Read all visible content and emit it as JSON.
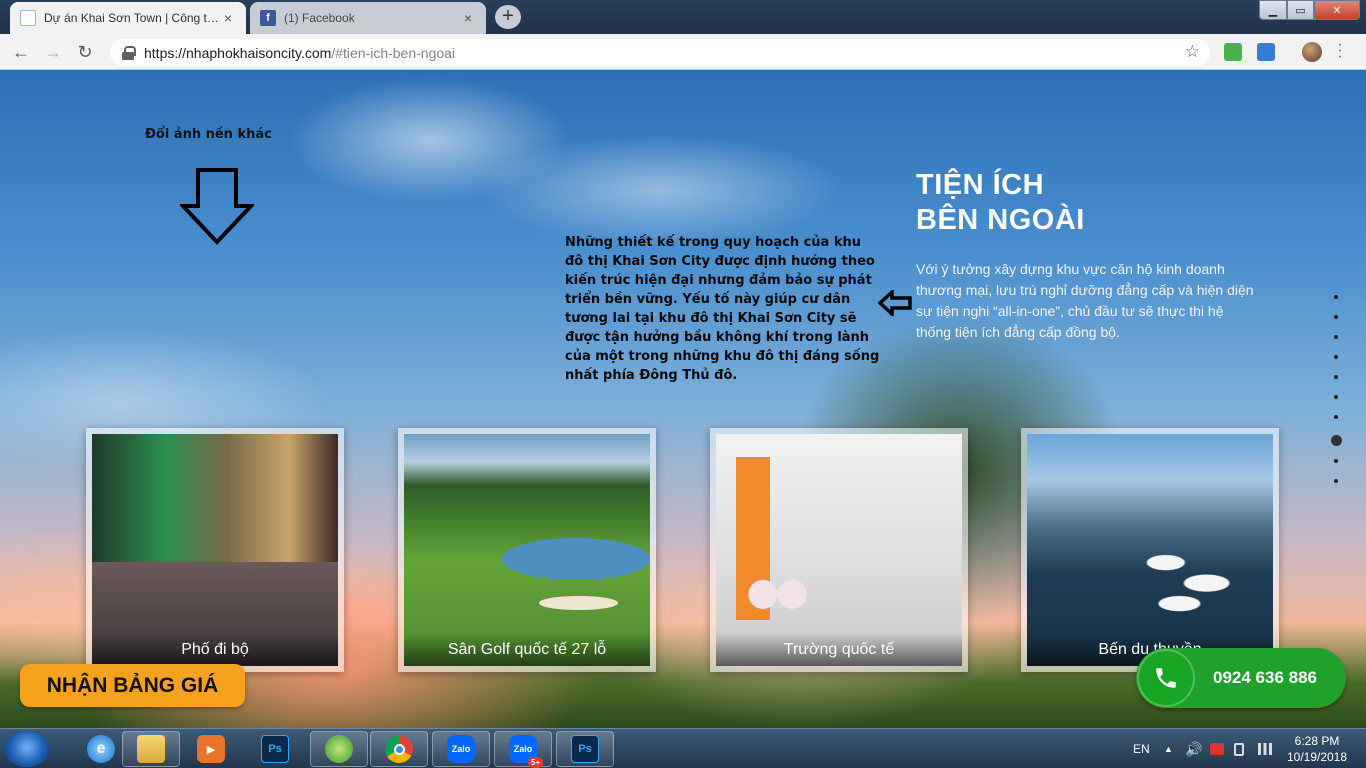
{
  "browser": {
    "tabs": [
      {
        "title": "Dự án Khai Sơn Town | Công ty C",
        "active": true,
        "favicon": "page-icon"
      },
      {
        "title": "(1) Facebook",
        "active": false,
        "favicon": "facebook-icon"
      }
    ],
    "close_glyph": "×",
    "new_tab_glyph": "+",
    "url_host": "https://nhaphokhaisoncity.com",
    "url_path": "/#tien-ich-ben-ngoai"
  },
  "page": {
    "hint": "Đổi ảnh nền khác",
    "description": "Những thiết kế trong quy hoạch của khu đô thị Khai Sơn City được định hướng theo kiến trúc hiện đại nhưng đảm bảo sự phát triển bền vững. Yếu tố này giúp cư dân tương lai tại khu đô thị Khai Sơn City sẽ được tận hưởng bầu không khí trong lành của một trong những khu đô thị đáng sống nhất phía Đông Thủ đô.",
    "section_title_line1": "TIỆN ÍCH",
    "section_title_line2": "BÊN NGOÀI",
    "section_text": "Với ý tưởng xây dựng khu vực căn hộ kinh doanh thương mại, lưu trú nghỉ dưỡng đẳng cấp và hiện diện sự tiện nghi “all-in-one”, chủ đầu tư sẽ thực thi hệ thống tiện ích đẳng cấp đồng bộ.",
    "cards": [
      {
        "label": "Phố đi bộ"
      },
      {
        "label": "Sân Golf quốc tế 27 lỗ"
      },
      {
        "label": "Trường quốc tế"
      },
      {
        "label": "Bến du thuyền"
      }
    ],
    "cta_label": "NHẬN BẢNG GIÁ",
    "phone_number": "0924 636 886",
    "dots_total": 10,
    "dots_active_index": 7
  },
  "taskbar": {
    "apps": [
      "file-explorer-icon",
      "internet-explorer-icon",
      "media-player-icon",
      "photoshop-icon",
      "coc-coc-icon",
      "chrome-icon",
      "zalo-icon",
      "zalo-icon",
      "photoshop-icon"
    ],
    "icon_text": {
      "ps": "Ps",
      "zalo": "Zalo",
      "zalo_badge": "5+"
    },
    "language": "EN",
    "time": "6:28 PM",
    "date": "10/19/2018"
  },
  "colors": {
    "cta": "#f6a21c",
    "phone": "#1fa12c",
    "tab_active": "#f2f2f2"
  }
}
